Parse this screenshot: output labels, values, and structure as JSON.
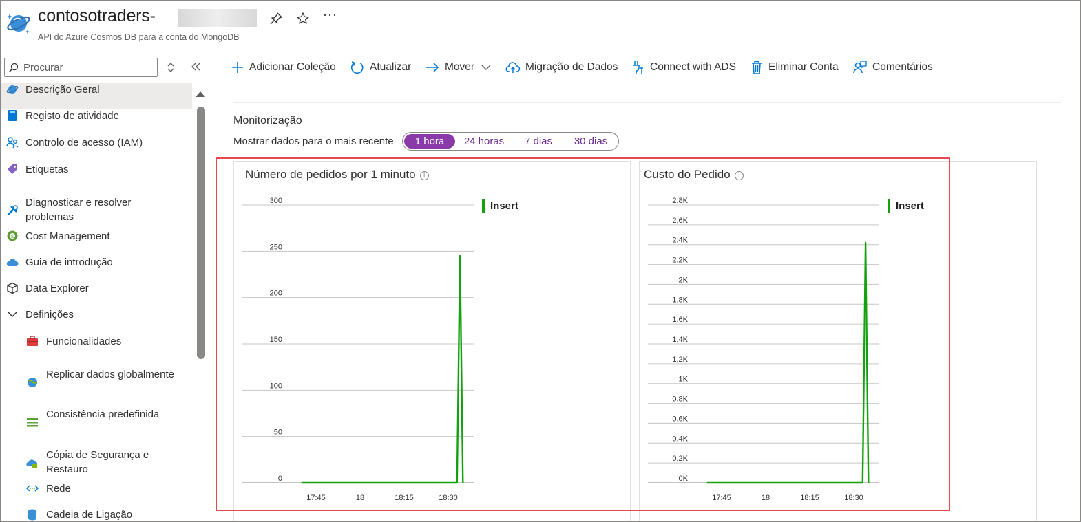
{
  "header": {
    "title": "contosotraders-",
    "subtitle": "API do Azure Cosmos DB para a conta do MongoDB",
    "more_label": "···"
  },
  "search": {
    "placeholder": "Procurar"
  },
  "toolbar": {
    "items": [
      {
        "label": "Adicionar Coleção",
        "icon": "plus-icon"
      },
      {
        "label": "Atualizar",
        "icon": "refresh-icon"
      },
      {
        "label": "Mover",
        "icon": "arrow-right-icon"
      },
      {
        "label": "Migração de Dados",
        "icon": "cloud-upload-icon"
      },
      {
        "label": "Connect with ADS",
        "icon": "connect-icon"
      },
      {
        "label": "Eliminar Conta",
        "icon": "trash-icon"
      },
      {
        "label": "Comentários",
        "icon": "feedback-icon"
      }
    ]
  },
  "sidebar": {
    "items": [
      {
        "label": "Descrição Geral",
        "icon": "cosmos-icon",
        "selected": true
      },
      {
        "label": "Registo de atividade",
        "icon": "log-icon"
      },
      {
        "label": "Controlo de acesso (IAM)",
        "icon": "people-icon"
      },
      {
        "label": "Etiquetas",
        "icon": "tag-icon"
      },
      {
        "label": "Diagnosticar e resolver problemas",
        "icon": "wrench-icon"
      },
      {
        "label": "Cost Management",
        "icon": "cost-icon"
      },
      {
        "label": "Guia de introdução",
        "icon": "cloud-icon"
      },
      {
        "label": "Data Explorer",
        "icon": "cube-icon"
      },
      {
        "label": "Definições",
        "icon": "chevron-down-icon",
        "section": true
      },
      {
        "label": "Funcionalidades",
        "icon": "toolbox-icon"
      },
      {
        "label": "Replicar dados globalmente",
        "icon": "globe-icon"
      },
      {
        "label": "Consistência predefinida",
        "icon": "lines-icon"
      },
      {
        "label": "Cópia de Segurança e Restauro",
        "icon": "backup-icon"
      },
      {
        "label": "Rede",
        "icon": "network-icon"
      },
      {
        "label": "Cadeia de Ligação",
        "icon": "database-icon"
      }
    ]
  },
  "monitoring": {
    "title": "Monitorização",
    "show_label": "Mostrar dados para o mais recente",
    "time_options": [
      "1 hora",
      "24 horas",
      "7 dias",
      "30 dias"
    ],
    "selected": "1 hora"
  },
  "colors": {
    "accent": "#8a3aa8",
    "series": "#13a10e",
    "highlight": "#e5484d"
  },
  "chart_data": [
    {
      "type": "line",
      "title": "Número de pedidos por 1 minuto",
      "x_ticks": [
        "17:45",
        "18",
        "18:15",
        "18:30"
      ],
      "y_ticks": [
        "0",
        "50",
        "100",
        "150",
        "200",
        "250",
        "300"
      ],
      "ylim": [
        0,
        300
      ],
      "legend": "top-right",
      "series": [
        {
          "name": "Insert",
          "points": [
            [
              "17:40",
              0
            ],
            [
              "18:33",
              0
            ],
            [
              "18:34",
              245
            ],
            [
              "18:35",
              0
            ]
          ]
        }
      ]
    },
    {
      "type": "line",
      "title": "Custo do Pedido",
      "x_ticks": [
        "17:45",
        "18",
        "18:15",
        "18:30"
      ],
      "y_ticks": [
        "0K",
        "0,2K",
        "0,4K",
        "0,6K",
        "0,8K",
        "1K",
        "1,2K",
        "1,4K",
        "1,6K",
        "1,8K",
        "2K",
        "2,2K",
        "2,4K",
        "2,6K",
        "2,8K"
      ],
      "ylim": [
        0,
        2800
      ],
      "legend": "top-right",
      "series": [
        {
          "name": "Insert",
          "points": [
            [
              "17:40",
              0
            ],
            [
              "18:33",
              0
            ],
            [
              "18:34",
              2420
            ],
            [
              "18:35",
              0
            ]
          ]
        }
      ]
    }
  ]
}
